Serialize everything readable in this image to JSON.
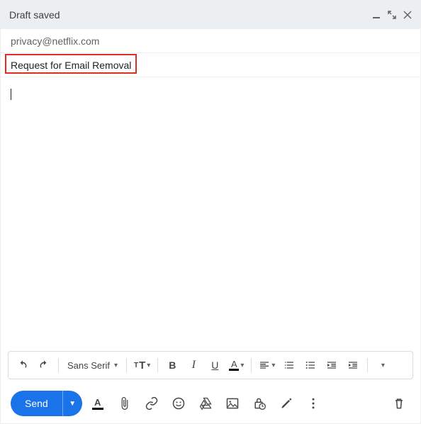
{
  "header": {
    "title": "Draft saved"
  },
  "fields": {
    "to": "privacy@netflix.com",
    "subject": "Request for Email Removal"
  },
  "body": "",
  "toolbar": {
    "font_family": "Sans Serif",
    "font_size_label": "T",
    "bold": "B",
    "italic": "I",
    "underline": "U",
    "text_color": "A"
  },
  "bottombar": {
    "send_label": "Send"
  }
}
